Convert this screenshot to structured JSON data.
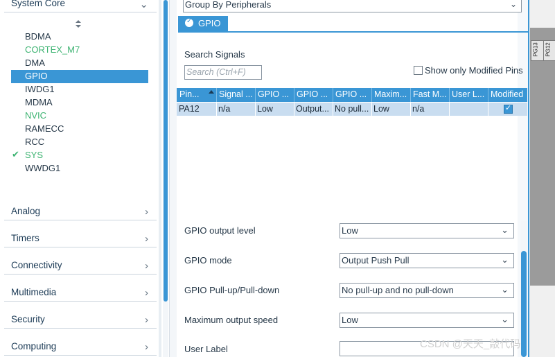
{
  "left_panel": {
    "top_category": "System Core",
    "peripherals": [
      {
        "label": "BDMA",
        "state": "normal"
      },
      {
        "label": "CORTEX_M7",
        "state": "green"
      },
      {
        "label": "DMA",
        "state": "normal"
      },
      {
        "label": "GPIO",
        "state": "selected"
      },
      {
        "label": "IWDG1",
        "state": "normal"
      },
      {
        "label": "MDMA",
        "state": "normal"
      },
      {
        "label": "NVIC",
        "state": "green"
      },
      {
        "label": "RAMECC",
        "state": "normal"
      },
      {
        "label": "RCC",
        "state": "normal"
      },
      {
        "label": "SYS",
        "state": "checked"
      },
      {
        "label": "WWDG1",
        "state": "normal"
      }
    ],
    "categories": [
      "Analog",
      "Timers",
      "Connectivity",
      "Multimedia",
      "Security",
      "Computing"
    ]
  },
  "config_panel": {
    "group_by": "Group By Peripherals",
    "tab_label": "GPIO",
    "search_label": "Search Signals",
    "search_placeholder": "Search (Ctrl+F)",
    "show_modified_label": "Show only Modified Pins",
    "show_modified_checked": false,
    "table": {
      "headers": [
        "Pin...",
        "Signal ...",
        "GPIO ...",
        "GPIO ...",
        "GPIO ...",
        "Maxim...",
        "Fast M...",
        "User L...",
        "Modified"
      ],
      "rows": [
        {
          "cells": [
            "PA12",
            "n/a",
            "Low",
            "Output...",
            "No pull...",
            "Low",
            "n/a",
            ""
          ],
          "modified": true
        }
      ]
    },
    "fields": [
      {
        "label": "GPIO output level",
        "value": "Low"
      },
      {
        "label": "GPIO mode",
        "value": "Output Push Pull"
      },
      {
        "label": "GPIO Pull-up/Pull-down",
        "value": "No pull-up and no pull-down"
      },
      {
        "label": "Maximum output speed",
        "value": "Low"
      },
      {
        "label": "User Label",
        "value": ""
      }
    ]
  },
  "pin_strip": {
    "pins": [
      "PG13",
      "PG12"
    ]
  },
  "watermark": "CSDN @天天_敲代码",
  "colors": {
    "accent": "#3a96d5",
    "enabled_green": "#3cb371",
    "selected_row": "#c9ddf0"
  }
}
